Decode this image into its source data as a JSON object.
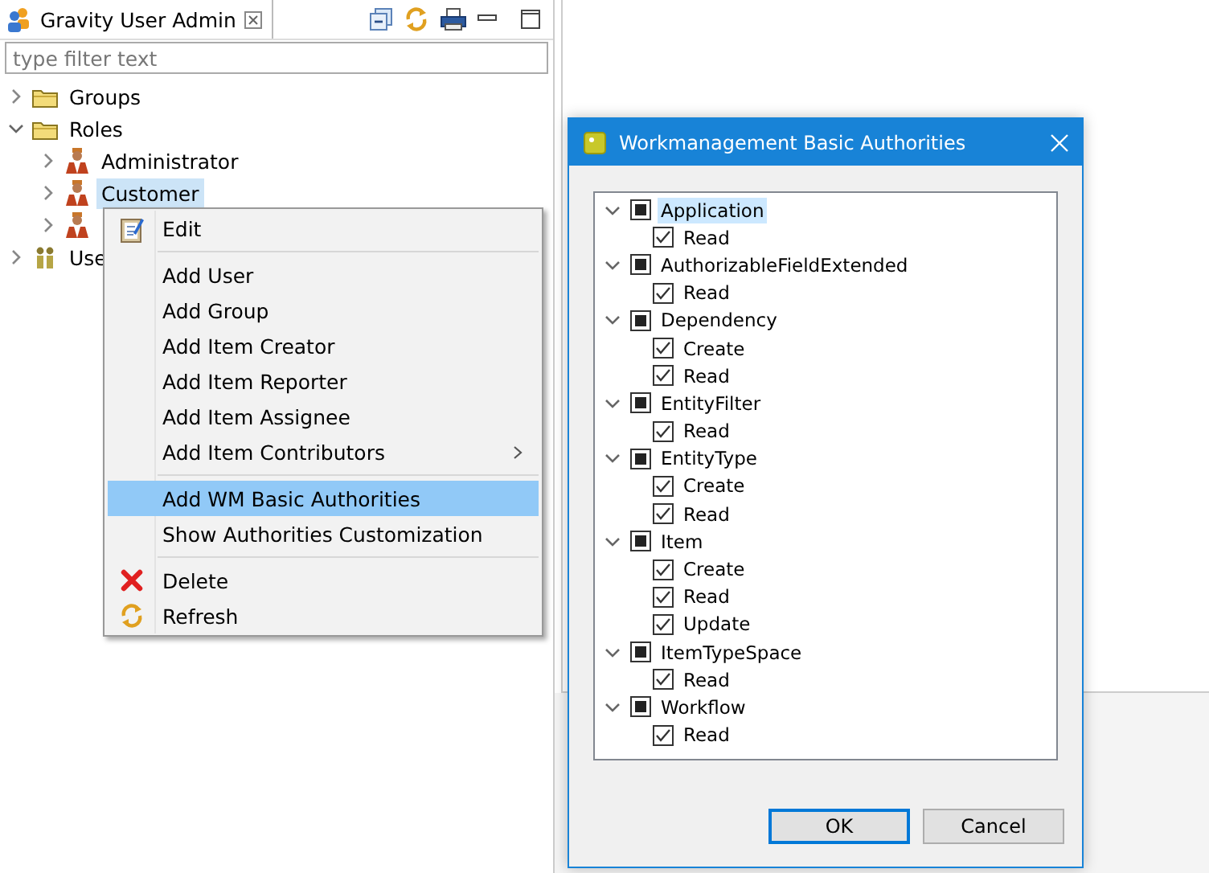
{
  "view": {
    "title": "Gravity User Admin"
  },
  "filter": {
    "placeholder": "type filter text"
  },
  "tree": [
    {
      "label": "Groups",
      "kind": "folder",
      "expanded": false,
      "selected": false
    },
    {
      "label": "Roles",
      "kind": "folder",
      "expanded": true,
      "selected": false,
      "children": [
        {
          "label": "Administrator",
          "kind": "role",
          "expanded": false,
          "selected": false
        },
        {
          "label": "Customer",
          "kind": "role",
          "expanded": false,
          "selected": true
        },
        {
          "kind": "role",
          "expanded": false,
          "selected": false
        }
      ]
    },
    {
      "label": "Use",
      "kind": "users",
      "expanded": false,
      "selected": false
    }
  ],
  "context_menu": {
    "items": [
      {
        "kind": "edit",
        "label": "Edit",
        "selected": false
      },
      {
        "kind": "separator"
      },
      {
        "kind": "item",
        "label": "Add User",
        "selected": false
      },
      {
        "kind": "item",
        "label": "Add Group",
        "selected": false
      },
      {
        "kind": "item",
        "label": "Add Item Creator",
        "selected": false
      },
      {
        "kind": "item",
        "label": "Add Item Reporter",
        "selected": false
      },
      {
        "kind": "item",
        "label": "Add Item Assignee",
        "selected": false
      },
      {
        "kind": "submenu",
        "label": "Add Item Contributors",
        "selected": false
      },
      {
        "kind": "separator"
      },
      {
        "kind": "item",
        "label": "Add WM Basic Authorities",
        "selected": true
      },
      {
        "kind": "item",
        "label": "Show Authorities Customization",
        "selected": false
      },
      {
        "kind": "separator"
      },
      {
        "kind": "delete",
        "label": "Delete",
        "selected": false
      },
      {
        "kind": "refresh",
        "label": "Refresh",
        "selected": false
      }
    ]
  },
  "dialog": {
    "title": "Workmanagement Basic Authorities",
    "tree": [
      {
        "label": "Application",
        "expanded": true,
        "mixed": true,
        "selected": true,
        "children": [
          {
            "label": "Read",
            "checked": true
          }
        ]
      },
      {
        "label": "AuthorizableFieldExtended",
        "expanded": true,
        "mixed": true,
        "selected": false,
        "children": [
          {
            "label": "Read",
            "checked": true
          }
        ]
      },
      {
        "label": "Dependency",
        "expanded": true,
        "mixed": true,
        "selected": false,
        "children": [
          {
            "label": "Create",
            "checked": true
          },
          {
            "label": "Read",
            "checked": true
          }
        ]
      },
      {
        "label": "EntityFilter",
        "expanded": true,
        "mixed": true,
        "selected": false,
        "children": [
          {
            "label": "Read",
            "checked": true
          }
        ]
      },
      {
        "label": "EntityType",
        "expanded": true,
        "mixed": true,
        "selected": false,
        "children": [
          {
            "label": "Create",
            "checked": true
          },
          {
            "label": "Read",
            "checked": true
          }
        ]
      },
      {
        "label": "Item",
        "expanded": true,
        "mixed": true,
        "selected": false,
        "children": [
          {
            "label": "Create",
            "checked": true
          },
          {
            "label": "Read",
            "checked": true
          },
          {
            "label": "Update",
            "checked": true
          }
        ]
      },
      {
        "label": "ItemTypeSpace",
        "expanded": true,
        "mixed": true,
        "selected": false,
        "children": [
          {
            "label": "Read",
            "checked": true
          }
        ]
      },
      {
        "label": "Workflow",
        "expanded": true,
        "mixed": true,
        "selected": false,
        "children": [
          {
            "label": "Read",
            "checked": true
          }
        ]
      }
    ],
    "buttons": [
      {
        "label": "OK",
        "default": true
      },
      {
        "label": "Cancel",
        "default": false
      }
    ]
  }
}
